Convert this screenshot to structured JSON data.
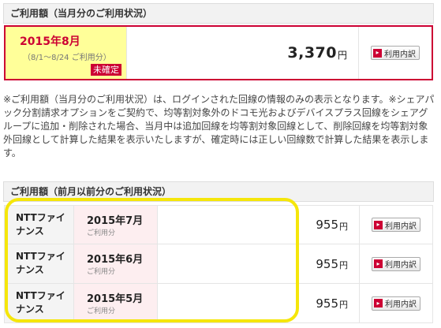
{
  "current_section": {
    "header": "ご利用額（当月分のご利用状況）",
    "month": "2015年8月",
    "range": "（8/1～8/24 ご利用分）",
    "status": "未確定",
    "amount": "3,370",
    "unit": "円",
    "detail_label": "利用内訳"
  },
  "notes": "※ご利用額（当月分のご利用状況）は、ログインされた回線の情報のみの表示となります。※シェアパック分割請求オプションをご契約で、均等割対象外のドコモ光およびデバイスプラス回線をシェアグループに追加・削除された場合、当月中は追加回線を均等割対象回線として、削除回線を均等割対象外回線として計算した結果を表示いたしますが、確定時には正しい回線数で計算した結果を表示します。",
  "previous_section": {
    "header": "ご利用額（前月以前分のご利用状況）",
    "rows": [
      {
        "provider": "NTTファイナンス",
        "month": "2015年7月",
        "sub": "ご利用分",
        "amount": "955",
        "unit": "円",
        "detail_label": "利用内訳"
      },
      {
        "provider": "NTTファイナンス",
        "month": "2015年6月",
        "sub": "ご利用分",
        "amount": "955",
        "unit": "円",
        "detail_label": "利用内訳"
      },
      {
        "provider": "NTTファイナンス",
        "month": "2015年5月",
        "sub": "ご利用分",
        "amount": "955",
        "unit": "円",
        "detail_label": "利用内訳"
      }
    ]
  },
  "colors": {
    "accent": "#cc0033",
    "current_month_bg": "#ffff99",
    "prev_month_bg": "#fdeef0",
    "highlight": "#f5e60a"
  },
  "icons": {
    "detail_button": "chevron-right-icon"
  }
}
